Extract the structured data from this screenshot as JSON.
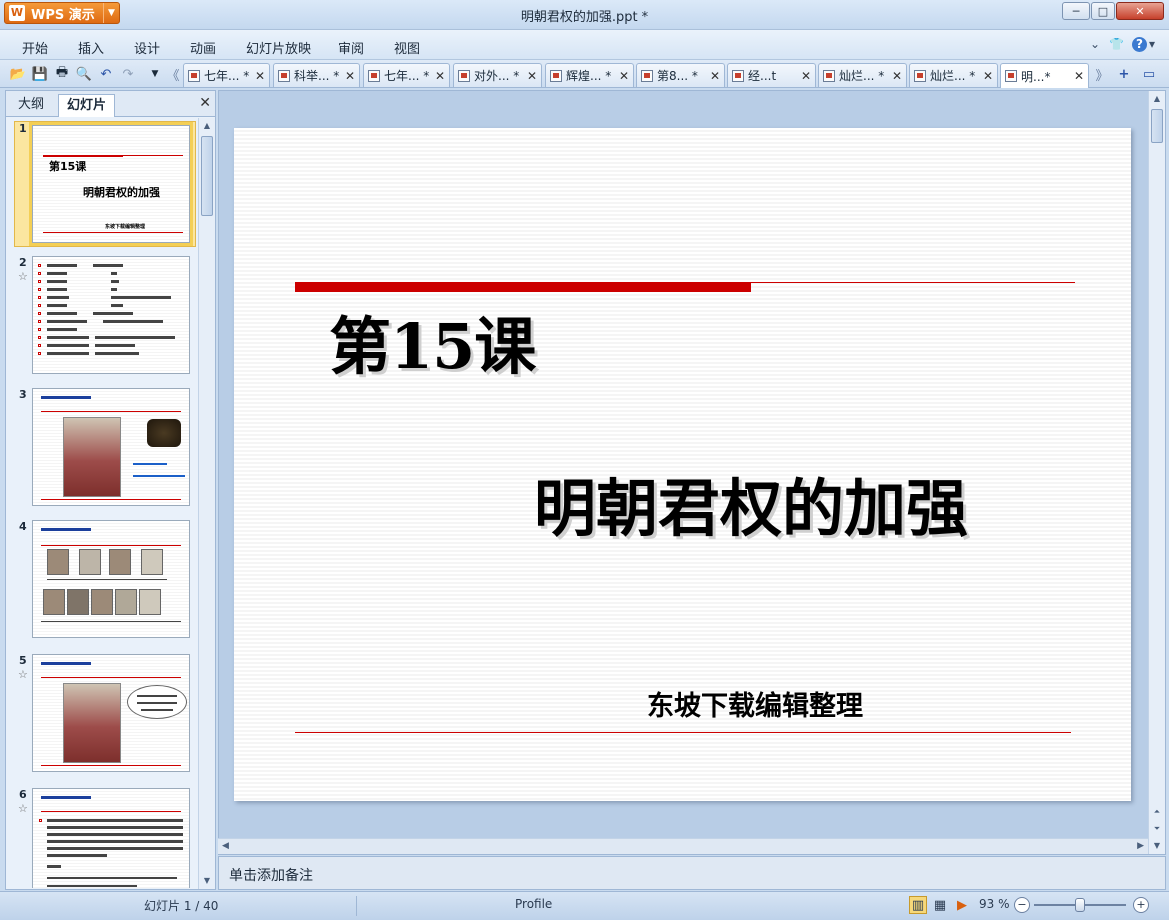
{
  "window": {
    "app_name": "WPS 演示",
    "app_logo": "W",
    "title": "明朝君权的加强.ppt *",
    "minimize": "─",
    "maximize": "□",
    "close": "✕"
  },
  "menu": {
    "items": [
      "开始",
      "插入",
      "设计",
      "动画",
      "幻灯片放映",
      "审阅",
      "视图"
    ],
    "right_icons": [
      "chevron-down-icon",
      "shirt-icon",
      "help-icon"
    ]
  },
  "tabs": [
    {
      "label": "七年... *"
    },
    {
      "label": "科举... *"
    },
    {
      "label": "七年... *"
    },
    {
      "label": "对外... *"
    },
    {
      "label": "辉煌... *"
    },
    {
      "label": "第8... *"
    },
    {
      "label": "经...t"
    },
    {
      "label": "灿烂... *"
    },
    {
      "label": "灿烂... *"
    },
    {
      "label": "明...*",
      "active": true
    }
  ],
  "panel": {
    "tab_outline": "大纲",
    "tab_slides": "幻灯片",
    "close": "✕",
    "thumbnails": [
      {
        "number": "1",
        "title": "第15课",
        "subtitle": "明朝君权的加强",
        "footer": "东坡下载编辑整理"
      },
      {
        "number": "2",
        "has_animation": true
      },
      {
        "number": "3"
      },
      {
        "number": "4"
      },
      {
        "number": "5",
        "has_animation": true
      },
      {
        "number": "6",
        "has_animation": true
      }
    ]
  },
  "slide": {
    "lesson": "第15课",
    "title": "明朝君权的加强",
    "footer": "东坡下载编辑整理"
  },
  "notes": {
    "placeholder": "单击添加备注"
  },
  "status": {
    "slide_count": "幻灯片 1 / 40",
    "profile": "Profile",
    "zoom": "93 %",
    "zoom_fraction": 0.5
  },
  "colors": {
    "accent_orange": "#de6a12",
    "slide_red": "#cc0000",
    "selection_yellow": "#f4cf55"
  }
}
